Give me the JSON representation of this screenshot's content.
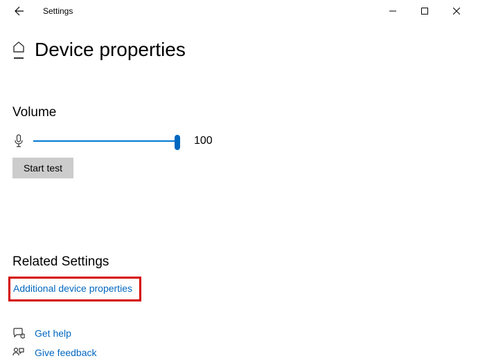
{
  "titlebar": {
    "title": "Settings"
  },
  "page": {
    "title": "Device properties"
  },
  "volume": {
    "label": "Volume",
    "value": "100",
    "start_test_label": "Start test"
  },
  "related": {
    "title": "Related Settings",
    "additional_link": "Additional device properties"
  },
  "footer": {
    "get_help": "Get help",
    "give_feedback": "Give feedback"
  },
  "colors": {
    "accent": "#0067c0",
    "highlight": "#d40000"
  }
}
